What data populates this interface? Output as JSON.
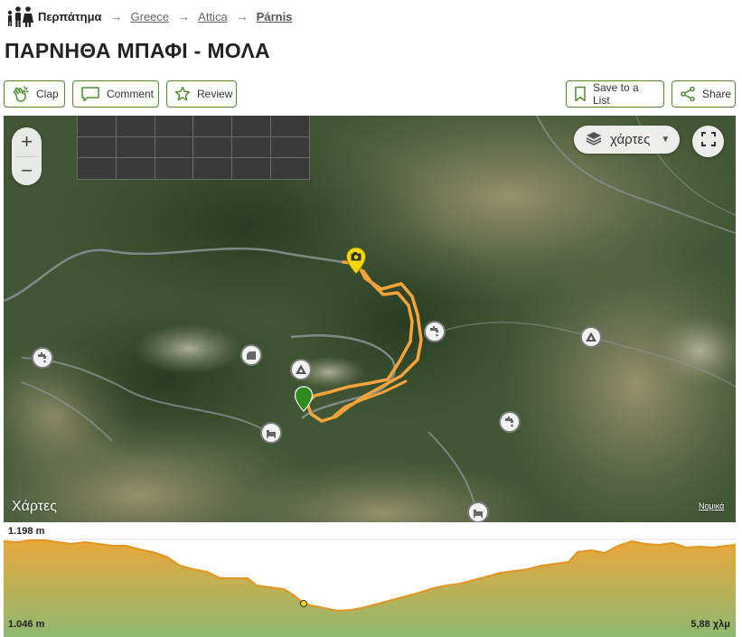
{
  "breadcrumb": {
    "activity": "Περπάτημα",
    "items": [
      "Greece",
      "Attica",
      "Párnis"
    ],
    "separator": "→"
  },
  "title": "ΠΑΡΝΗΘΑ ΜΠΑΦΙ - ΜΟΛΑ",
  "actions": {
    "clap": "Clap",
    "comment": "Comment",
    "review": "Review",
    "save": "Save to a List",
    "share": "Share"
  },
  "map": {
    "zoom_in": "+",
    "zoom_out": "−",
    "layer_label": "χάρτες",
    "brand": "Χάρτες",
    "legal": "Νομικά",
    "route_color": "#f5a33a",
    "start_marker_color": "#2e8b1e",
    "photo_marker_color": "#f2d800",
    "poi_icons": [
      "water-tap-icon",
      "shelter-icon",
      "summit-icon",
      "water-tap-icon",
      "summit-icon",
      "water-tap-icon",
      "refuge-icon",
      "refuge-icon"
    ]
  },
  "elevation": {
    "max_label": "1.198 m",
    "min_label": "1.046 m",
    "distance_label": "5,88 χλμ",
    "max_m": 1198,
    "min_m": 1046,
    "distance_km": 5.88,
    "fill_top": "#e9a83a",
    "fill_bottom": "#8fb970"
  }
}
